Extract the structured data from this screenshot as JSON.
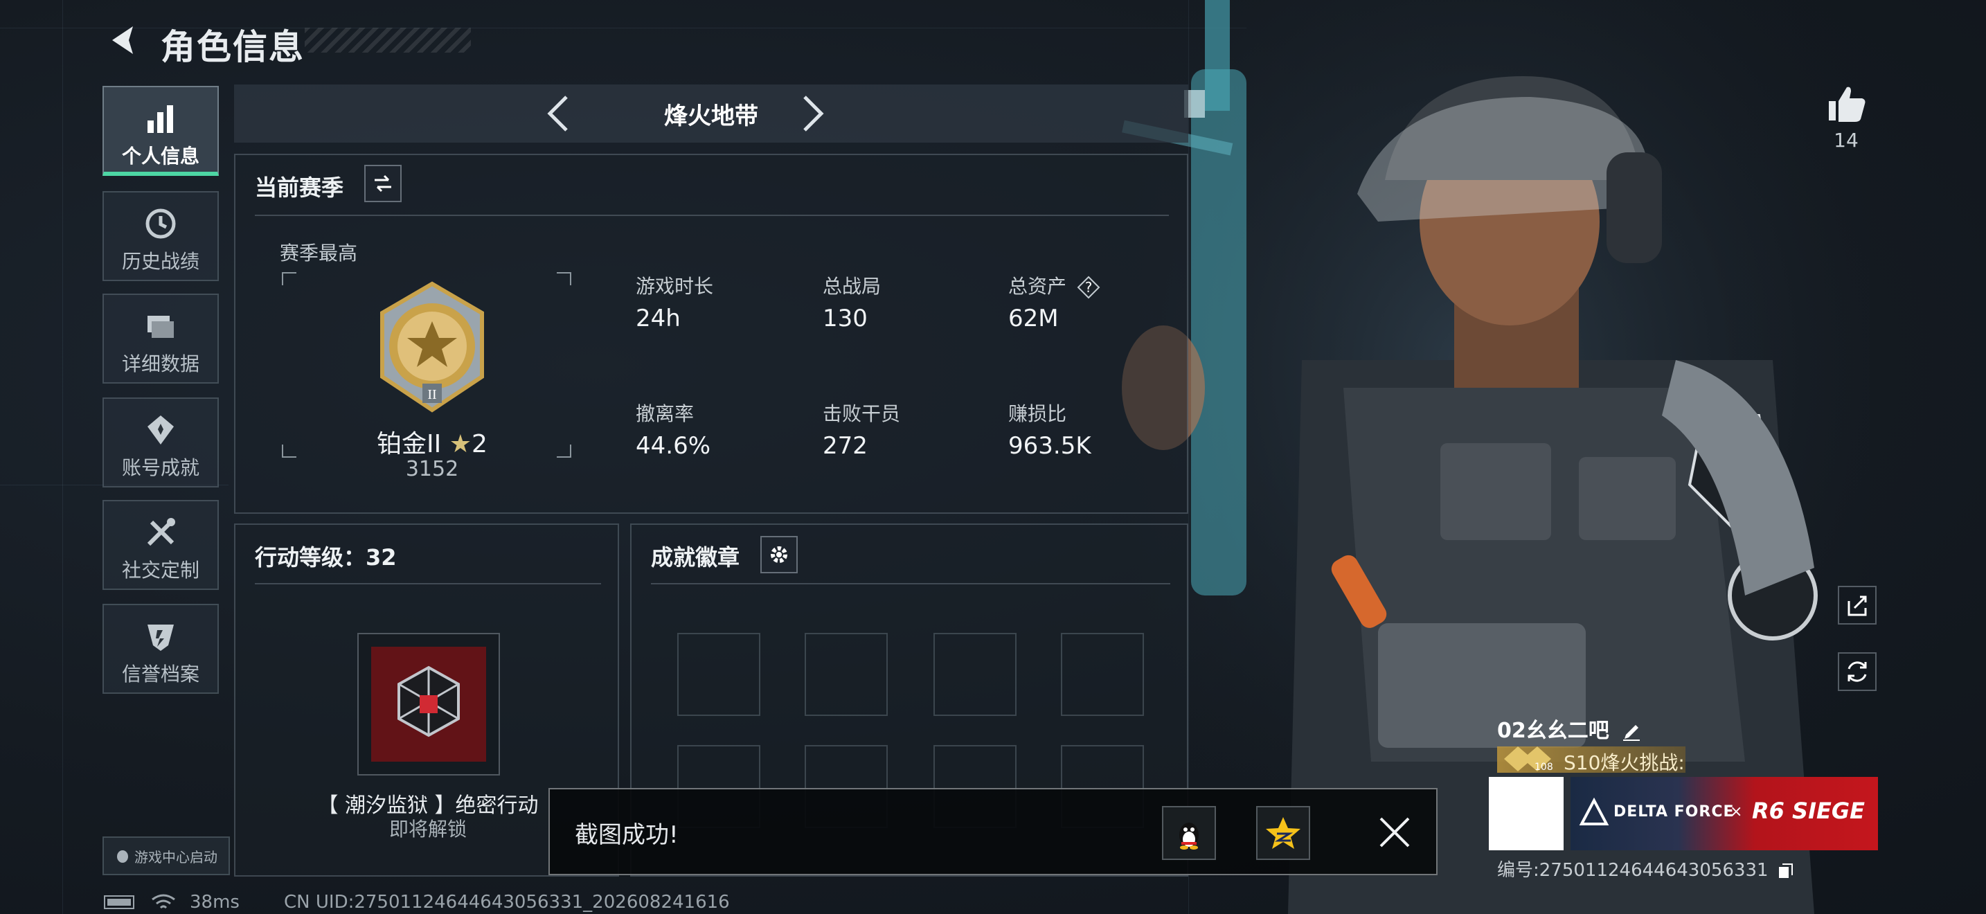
{
  "header": {
    "title": "角色信息"
  },
  "nav": {
    "items": [
      {
        "label": "个人信息",
        "icon": "bar-chart-icon",
        "active": true
      },
      {
        "label": "历史战绩",
        "icon": "history-clock-icon",
        "active": false
      },
      {
        "label": "详细数据",
        "icon": "folder-icon",
        "active": false
      },
      {
        "label": "账号成就",
        "icon": "medal-icon",
        "active": false
      },
      {
        "label": "社交定制",
        "icon": "tools-icon",
        "active": false
      },
      {
        "label": "信誉档案",
        "icon": "shield-icon",
        "active": false
      }
    ],
    "launch_label": "游戏中心启动"
  },
  "mode": {
    "name": "烽火地带"
  },
  "season": {
    "title": "当前赛季",
    "best_label": "赛季最高",
    "rank_name": "铂金II",
    "rank_stars": "2",
    "rank_score": "3152",
    "stats": [
      {
        "label": "游戏时长",
        "value": "24h"
      },
      {
        "label": "总战局",
        "value": "130"
      },
      {
        "label": "总资产",
        "value": "62M"
      },
      {
        "label": "撤离率",
        "value": "44.6%"
      },
      {
        "label": "击败干员",
        "value": "272"
      },
      {
        "label": "赚损比",
        "value": "963.5K"
      }
    ]
  },
  "level": {
    "title": "行动等级：32",
    "item_name": "【 潮汐监狱 】绝密行动",
    "item_status": "即将解锁"
  },
  "badges": {
    "title": "成就徽章"
  },
  "toast": {
    "text": "截图成功!"
  },
  "status": {
    "ping": "38ms",
    "uid": "CN UID:27501124644643056331_202608241616"
  },
  "profile": {
    "likes": "14",
    "player_name": "02幺幺二吧",
    "season_tag_level": "108",
    "season_tag": "S10烽火挑战:",
    "collab_left": "DELTA FORCE",
    "collab_x": "×",
    "collab_right": "R6 SIEGE",
    "player_id": "编号:27501124644643056331"
  },
  "colors": {
    "accent": "#4dd6a4",
    "panel_border": "#6e7d87",
    "gold": "#c9a24a"
  }
}
